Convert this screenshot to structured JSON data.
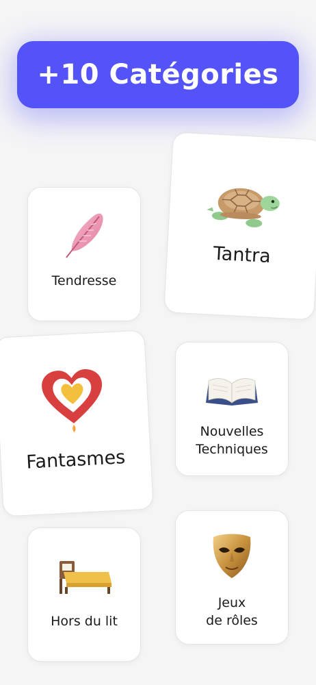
{
  "header": {
    "title": "+10 Catégories"
  },
  "categories": [
    {
      "label": "Tendresse",
      "icon": "feather-icon"
    },
    {
      "label": "Tantra",
      "icon": "turtle-icon"
    },
    {
      "label": "Fantasmes",
      "icon": "heart-candle-icon"
    },
    {
      "label": "Nouvelles\nTechniques",
      "icon": "open-book-icon"
    },
    {
      "label": "Hors du lit",
      "icon": "bed-icon"
    },
    {
      "label": "Jeux\nde rôles",
      "icon": "mask-icon"
    }
  ],
  "colors": {
    "accent": "#5353f7",
    "background": "#f5f5f6",
    "card": "#ffffff"
  }
}
